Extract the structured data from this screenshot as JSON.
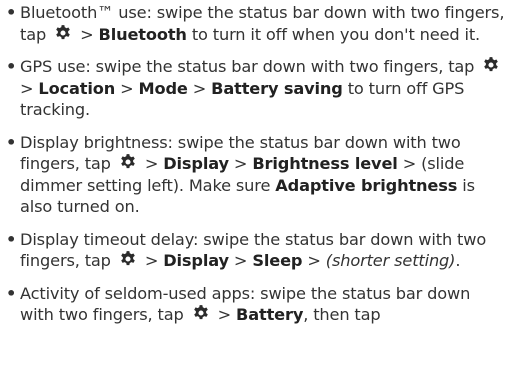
{
  "tips": {
    "bullet": "•",
    "settings_icon": "gear-icon",
    "items": [
      {
        "lead": "Bluetooth™ use: swipe the status bar down with two fingers, tap",
        "sep1": ">",
        "path1": "Bluetooth",
        "tail": "to turn it off when you don't need it."
      },
      {
        "lead": "GPS use: swipe the status bar down with two fingers, tap",
        "sep1": ">",
        "path1": "Location",
        "sep2": ">",
        "path2": "Mode",
        "sep3": ">",
        "path3": "Battery saving",
        "tail": "to turn off GPS tracking."
      },
      {
        "lead": "Display brightness: swipe the status bar down with two fingers, tap",
        "sep1": ">",
        "path1": "Display",
        "sep2": ">",
        "path2": "Brightness level",
        "sep3": ">",
        "mid": "(slide dimmer setting left). Make sure",
        "emph": "Adaptive brightness",
        "tail": "is also turned on."
      },
      {
        "lead": "Display timeout delay: swipe the status bar down with two fingers, tap",
        "sep1": ">",
        "path1": "Display",
        "sep2": ">",
        "path2": "Sleep",
        "sep3": ">",
        "ital": "(shorter setting)",
        "tail": "."
      },
      {
        "lead": "Activity of seldom-used apps: swipe the status bar down with two fingers, tap",
        "sep1": ">",
        "path1": "Battery",
        "tail": ", then tap"
      }
    ]
  }
}
